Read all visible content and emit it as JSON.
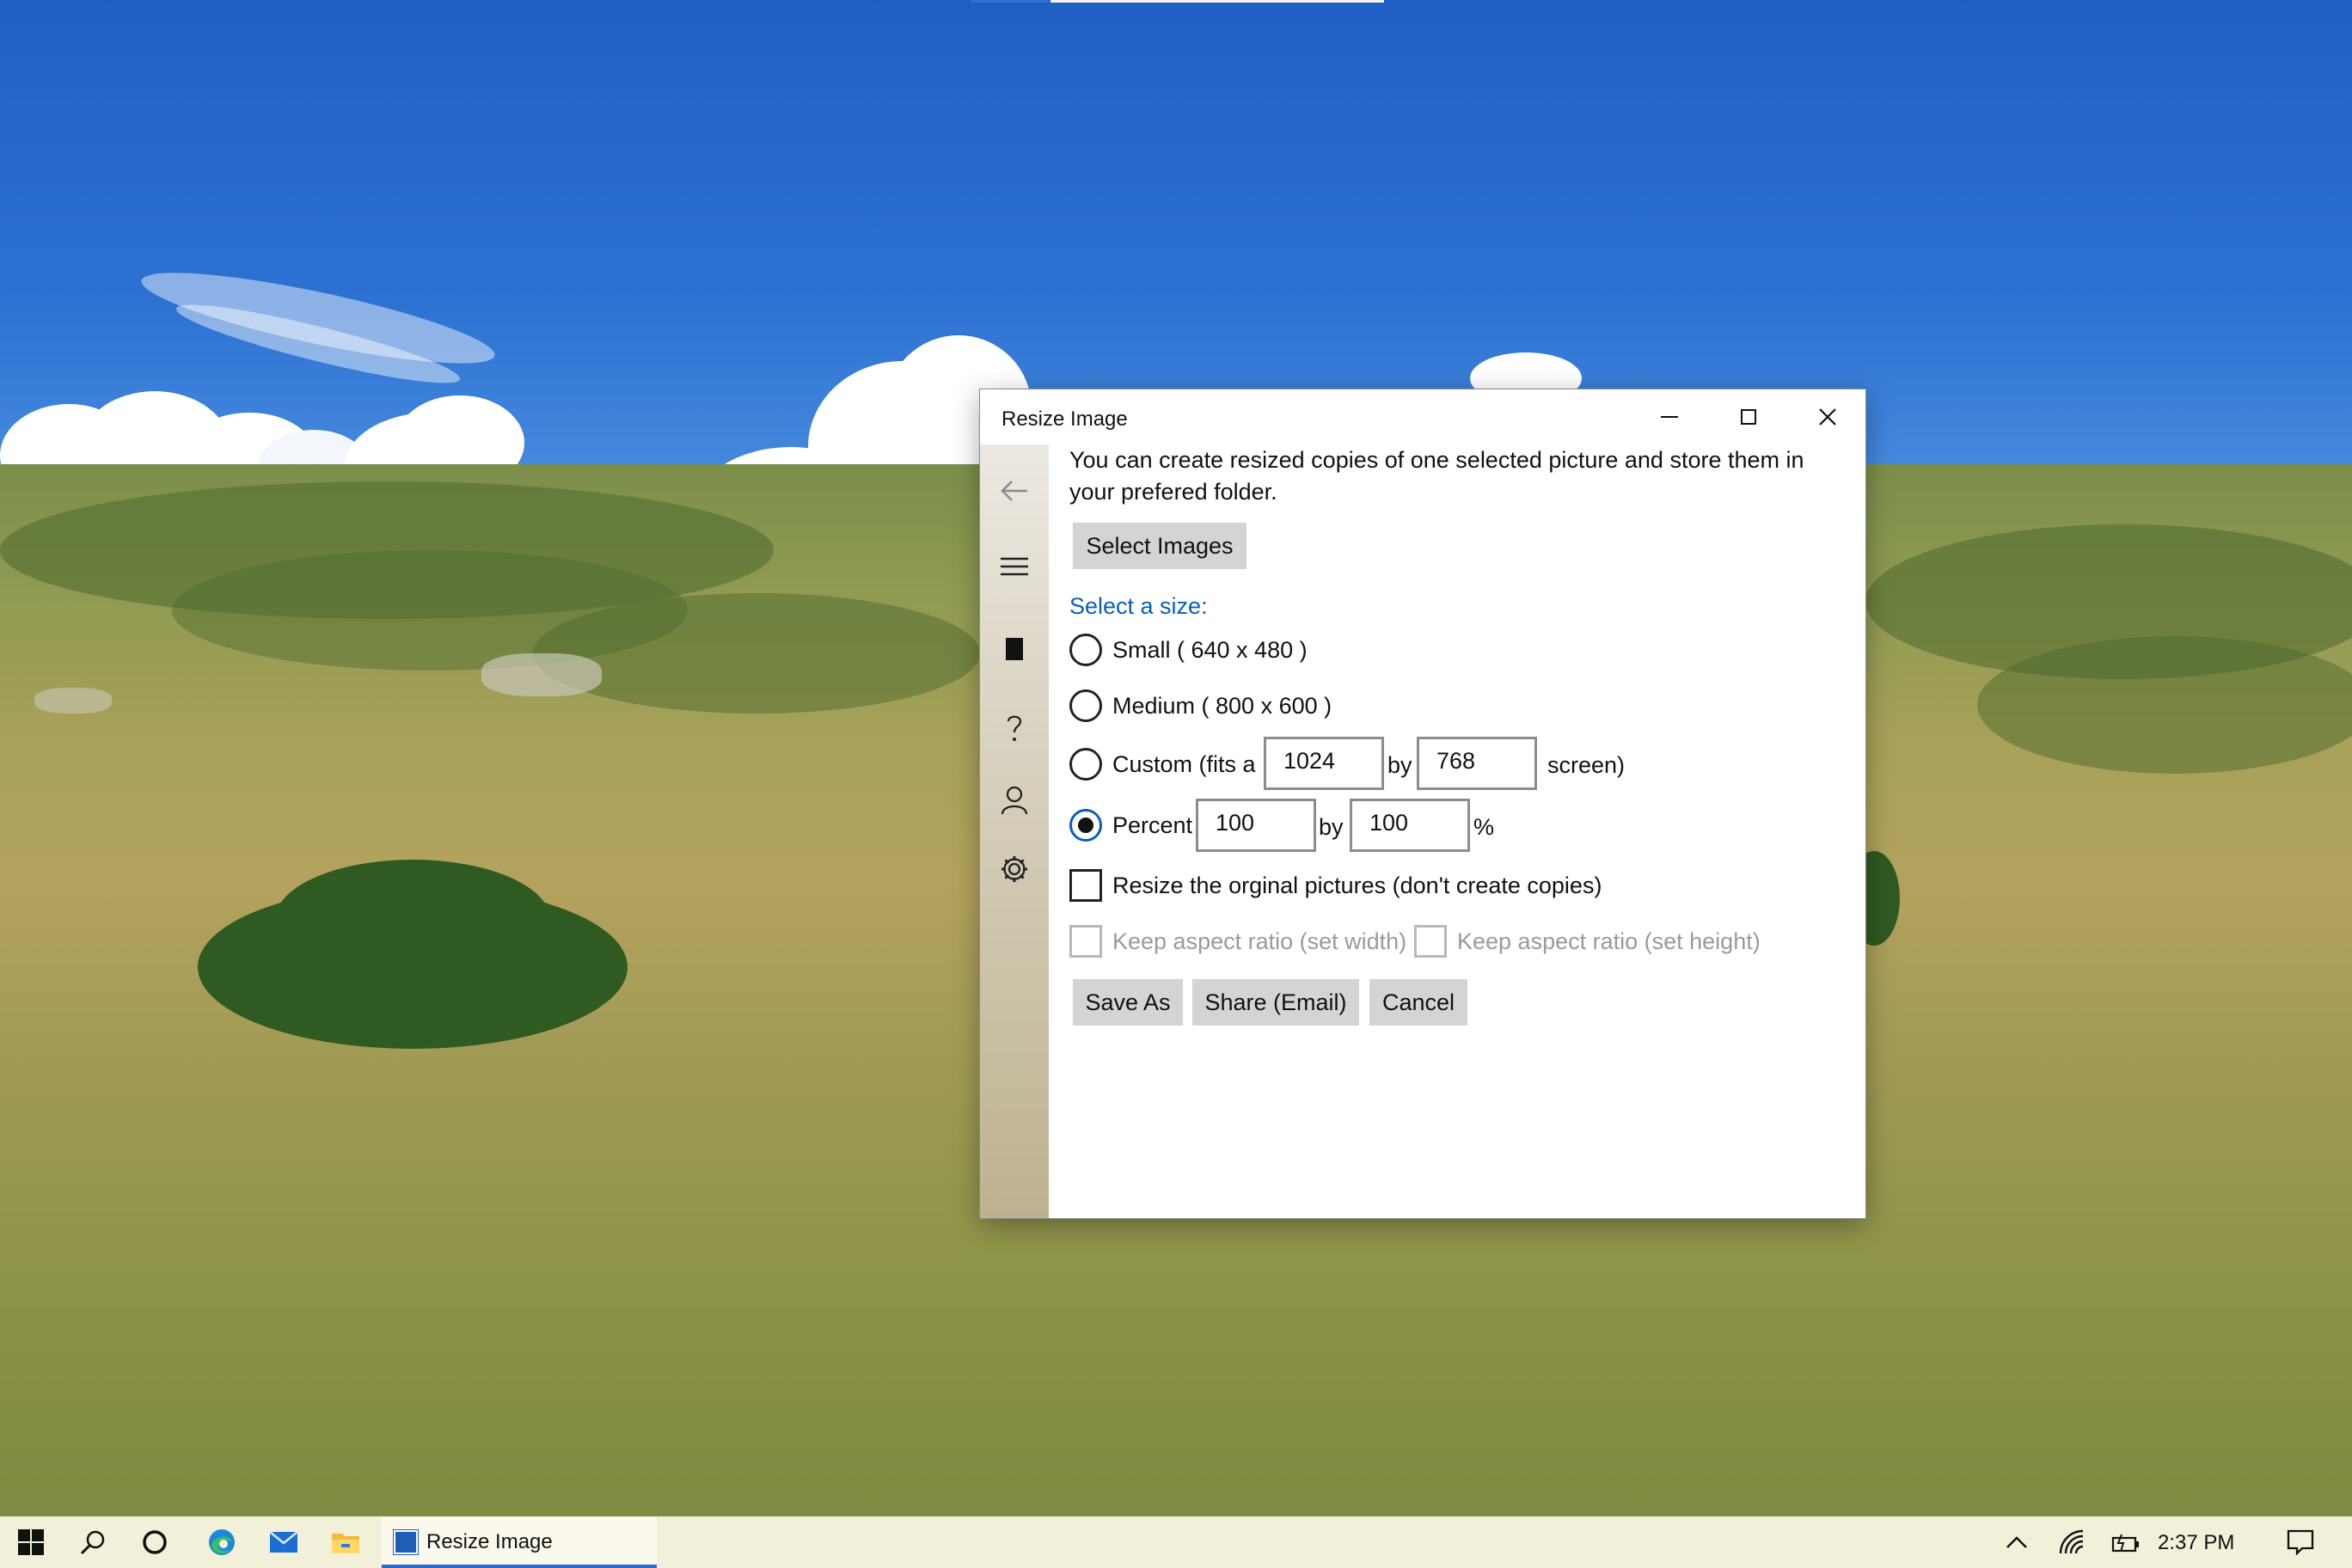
{
  "window": {
    "title": "Resize Image",
    "description": "You can create resized copies of one selected picture and store them in your prefered folder.",
    "select_images_label": "Select Images",
    "size_section_label": "Select a size:",
    "options": {
      "small": "Small ( 640 x 480 )",
      "medium": "Medium ( 800 x 600 )",
      "custom_prefix": "Custom (fits a",
      "custom_by": "by",
      "custom_suffix": "screen)",
      "custom_width": "1024",
      "custom_height": "768",
      "percent_label": "Percent",
      "percent_by": "by",
      "percent_suffix": "%",
      "percent_width": "100",
      "percent_height": "100",
      "selected": "percent"
    },
    "checkboxes": {
      "resize_original": "Resize the orginal pictures (don't create copies)",
      "keep_aspect_width": "Keep aspect ratio (set width)",
      "keep_aspect_height": "Keep aspect ratio (set height)"
    },
    "buttons": {
      "save_as": "Save As",
      "share_email": "Share (Email)",
      "cancel": "Cancel"
    },
    "sidebar_icons": [
      "back-arrow-icon",
      "hamburger-menu-icon",
      "image-icon",
      "help-icon",
      "account-icon",
      "settings-icon"
    ]
  },
  "taskbar": {
    "app_label": "Resize Image",
    "clock": "2:37 PM",
    "accent_color": "#2a6ad0"
  }
}
